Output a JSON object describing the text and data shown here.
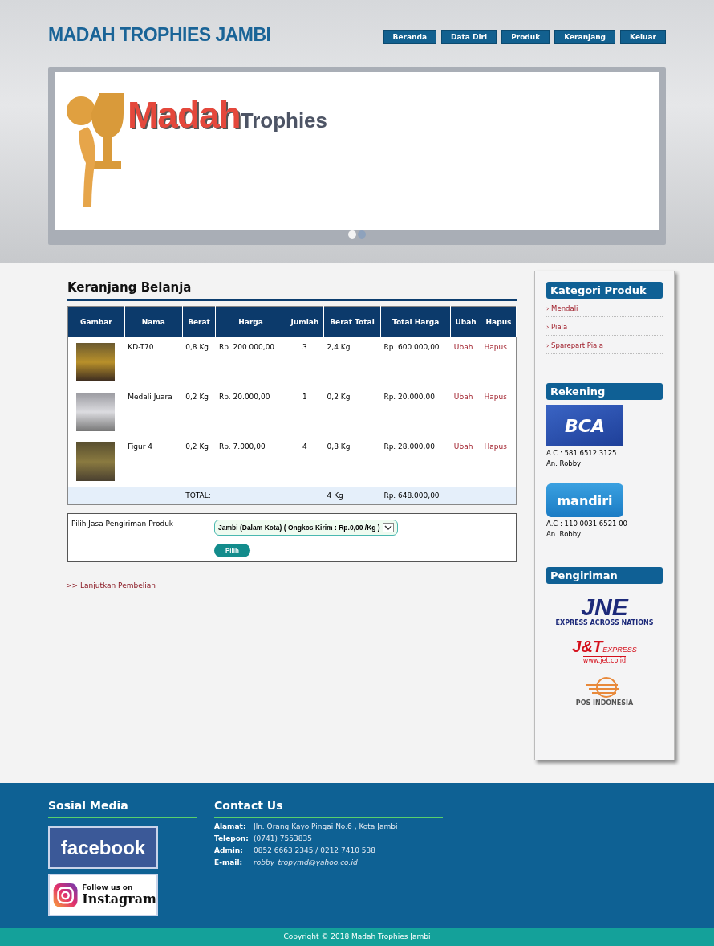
{
  "header": {
    "site_title": "MADAH TROPHIES JAMBI",
    "nav": [
      {
        "label": "Beranda"
      },
      {
        "label": "Data Diri"
      },
      {
        "label": "Produk"
      },
      {
        "label": "Keranjang"
      },
      {
        "label": "Keluar"
      }
    ]
  },
  "banner": {
    "logo_word_1": "Madah",
    "logo_word_2": "Trophies",
    "dots": [
      {
        "selected": true
      },
      {
        "selected": false
      }
    ]
  },
  "cart": {
    "title": "Keranjang Belanja",
    "columns": [
      "Gambar",
      "Nama",
      "Berat",
      "Harga",
      "Jumlah",
      "Berat Total",
      "Total Harga",
      "Ubah",
      "Hapus"
    ],
    "rows": [
      {
        "name": "KD-T70",
        "weight": "0,8 Kg",
        "price": "Rp. 200.000,00",
        "qty": "3",
        "total_weight": "2,4 Kg",
        "total_price": "Rp. 600.000,00",
        "edit": "Ubah",
        "delete": "Hapus"
      },
      {
        "name": "Medali Juara",
        "weight": "0,2 Kg",
        "price": "Rp. 20.000,00",
        "qty": "1",
        "total_weight": "0,2 Kg",
        "total_price": "Rp. 20.000,00",
        "edit": "Ubah",
        "delete": "Hapus"
      },
      {
        "name": "Figur 4",
        "weight": "0,2 Kg",
        "price": "Rp. 7.000,00",
        "qty": "4",
        "total_weight": "0,8 Kg",
        "total_price": "Rp. 28.000,00",
        "edit": "Ubah",
        "delete": "Hapus"
      }
    ],
    "total": {
      "label": "TOTAL:",
      "weight": "4 Kg",
      "price": "Rp. 648.000,00"
    }
  },
  "shipping": {
    "label": "Pilih Jasa Pengiriman Produk",
    "value": "Jambi (Dalam Kota) ( Ongkos Kirim : Rp.0,00 /Kg )",
    "button": "Pilih"
  },
  "continue_link": ">> Lanjutkan Pembelian",
  "sidebar": {
    "category_title": "Kategori Produk",
    "categories": [
      "› Mendali",
      "› Piala",
      "› Sparepart Piala"
    ],
    "account_title": "Rekening",
    "accounts": [
      {
        "kind": "bca",
        "logo": "BCA",
        "number": "A.C : 581 6512 3125",
        "holder": "An. Robby"
      },
      {
        "kind": "mandiri",
        "logo": "mandiri",
        "number": "A.C : 110 0031 6521 00",
        "holder": "An. Robby"
      }
    ],
    "shipping_title": "Pengiriman",
    "couriers": [
      {
        "kind": "jne",
        "name": "JNE",
        "tagline": "EXPRESS ACROSS NATIONS"
      },
      {
        "kind": "jnt",
        "name": "J&T",
        "tagline": "EXPRESS",
        "url": "www.jet.co.id"
      },
      {
        "kind": "pos",
        "name": "POS INDONESIA"
      }
    ]
  },
  "footer": {
    "social_title": "Sosial Media",
    "facebook": "facebook",
    "instagram_top": "Follow us on",
    "instagram_bottom": "Instagram",
    "contact_title": "Contact Us",
    "contacts": [
      {
        "label": "Alamat:",
        "value": "Jln. Orang Kayo Pingai No.6 , Kota Jambi",
        "kind": "plain"
      },
      {
        "label": "Telepon:",
        "value": "(0741) 7553835",
        "kind": "plain"
      },
      {
        "label": "Admin:",
        "value": "0852 6663 2345 / 0212 7410 538",
        "kind": "plain"
      },
      {
        "label": "E-mail:",
        "value": "robby_tropymd@yahoo.co.id",
        "kind": "email"
      }
    ],
    "copyright": "Copyright © 2018 Madah Trophies Jambi"
  }
}
